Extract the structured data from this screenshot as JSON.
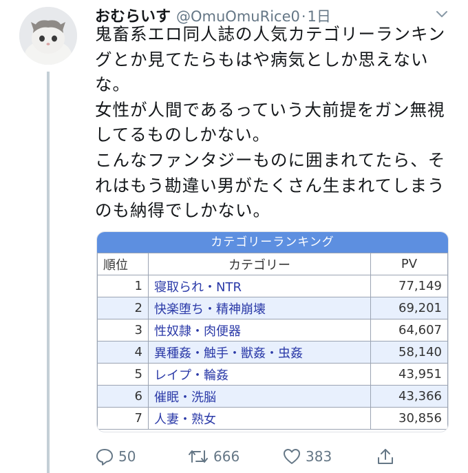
{
  "tweet": {
    "author_name": "おむらいす",
    "author_handle": "@OmuOmuRice0",
    "separator": "·",
    "time": "1日",
    "text_lines": [
      "鬼畜系エロ同人誌の人気カテゴリーランキン",
      "グとか見てたらもはや病気としか思えない",
      "な。",
      "女性が人間であるっていう大前提をガン無視",
      "してるものしかない。",
      "こんなファンタジーものに囲まれてたら、そ",
      "れはもう勘違い男がたくさん生まれてしまう",
      "のも納得でしかない。"
    ],
    "actions": {
      "replies": "50",
      "retweets": "666",
      "likes": "383"
    }
  },
  "card": {
    "title": "カテゴリーランキング",
    "headers": {
      "rank": "順位",
      "category": "カテゴリー",
      "pv": "PV"
    },
    "rows": [
      {
        "rank": "1",
        "category": "寝取られ・NTR",
        "pv": "77,149"
      },
      {
        "rank": "2",
        "category": "快楽堕ち・精神崩壊",
        "pv": "69,201"
      },
      {
        "rank": "3",
        "category": "性奴隷・肉便器",
        "pv": "64,607"
      },
      {
        "rank": "4",
        "category": "異種姦・触手・獣姦・虫姦",
        "pv": "58,140"
      },
      {
        "rank": "5",
        "category": "レイプ・輪姦",
        "pv": "43,951"
      },
      {
        "rank": "6",
        "category": "催眠・洗脳",
        "pv": "43,366"
      },
      {
        "rank": "7",
        "category": "人妻・熟女",
        "pv": "30,856"
      }
    ]
  },
  "colors": {
    "card_header": "#5d8fe0",
    "row_highlight": "#e8f0fd",
    "link_text": "#2b3aa8",
    "muted": "#657786",
    "thread_line": "#c4cfd6"
  },
  "icons": {
    "avatar": "cat-avatar",
    "menu": "chevron-down-icon",
    "reply": "reply-icon",
    "retweet": "retweet-icon",
    "like": "heart-icon",
    "share": "share-icon"
  }
}
